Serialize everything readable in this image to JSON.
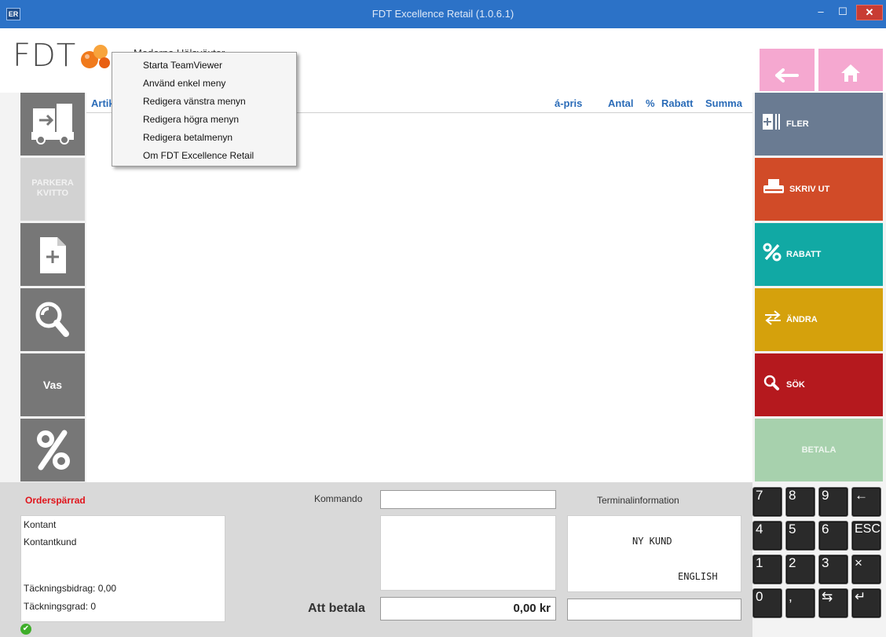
{
  "window": {
    "title": "FDT Excellence Retail (1.0.6.1)",
    "app_icon": "ER",
    "min_label": "–",
    "max_label": "☐",
    "close_label": "✕"
  },
  "header": {
    "logo_text": "FDT",
    "store_name": "Moderna Hälsväxter"
  },
  "nav": {
    "back_icon": "arrow-left-icon",
    "home_icon": "home-icon"
  },
  "grid": {
    "columns": [
      "Artikel",
      "á-pris",
      "Antal",
      "%",
      "Rabatt",
      "Summa"
    ],
    "rows": []
  },
  "left_menu": [
    {
      "icon": "truck-icon",
      "label": ""
    },
    {
      "icon": "",
      "label": "PARKERA\nKVITTO",
      "disabled": true
    },
    {
      "icon": "new-document-icon",
      "label": ""
    },
    {
      "icon": "search-icon",
      "label": ""
    },
    {
      "icon": "",
      "label": "Vas"
    },
    {
      "icon": "percent-icon",
      "label": ""
    }
  ],
  "right_menu": [
    {
      "label": "FLER",
      "color": "#6a7b92",
      "icon": "more-icon"
    },
    {
      "label": "SKRIV UT",
      "color": "#d14b28",
      "icon": "printer-icon"
    },
    {
      "label": "RABATT",
      "color": "#11a9a4",
      "icon": "percent-icon"
    },
    {
      "label": "ÄNDRA",
      "color": "#d5a10c",
      "icon": "swap-icon"
    },
    {
      "label": "SÖK",
      "color": "#b5191e",
      "icon": "search-icon"
    },
    {
      "label": "BETALA",
      "color": "#a7d1ad",
      "icon": ""
    }
  ],
  "bottom": {
    "order_status": "Orderspärrad",
    "customer_lines": [
      "Kontant",
      "Kontantkund"
    ],
    "tackningsbidrag": "Täckningsbidrag: 0,00",
    "tackningsgrad": "Täckningsgrad: 0",
    "kommando_label": "Kommando",
    "kommando_value": "",
    "att_betala_label": "Att betala",
    "att_betala_value": "0,00 kr",
    "terminal_label": "Terminalinformation",
    "terminal_lines": [
      "NY KUND",
      "ENGLISH"
    ]
  },
  "numpad": {
    "keys": [
      "7",
      "8",
      "9",
      "←",
      "4",
      "5",
      "6",
      "ESC",
      "1",
      "2",
      "3",
      "×",
      "0",
      ",",
      "⇆",
      "↵"
    ]
  },
  "context_menu": {
    "items": [
      "Starta TeamViewer",
      "Använd enkel meny",
      "Redigera vänstra menyn",
      "Redigera högra menyn",
      "Redigera betalmenyn",
      "Om FDT Excellence Retail"
    ]
  }
}
